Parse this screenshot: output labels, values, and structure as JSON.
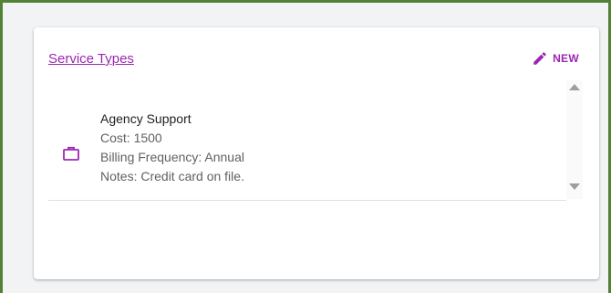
{
  "card": {
    "title": "Service Types",
    "new_label": "NEW",
    "new_icon": "pencil-icon"
  },
  "service_types": [
    {
      "name": "Agency Support",
      "cost": "Cost: 1500",
      "billing_frequency": "Billing Frequency: Annual",
      "notes": "Notes: Credit card on file.",
      "icon": "briefcase-icon"
    }
  ],
  "colors": {
    "accent": "#9c27b0",
    "frame_border": "#548235",
    "background": "#f1f3f4",
    "card": "#ffffff"
  }
}
